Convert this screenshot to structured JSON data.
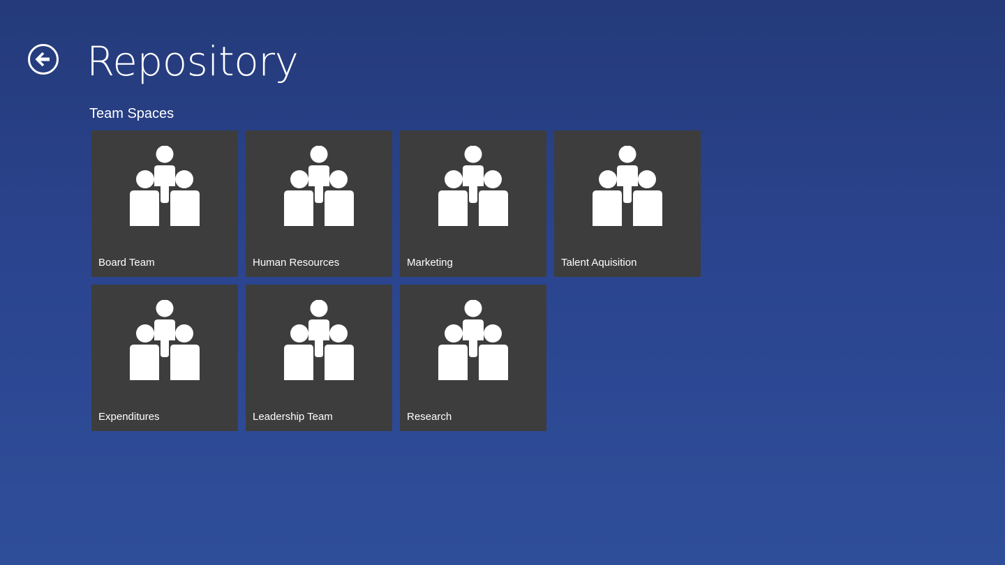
{
  "header": {
    "title": "Repository",
    "back_icon": "back-arrow-circle-icon"
  },
  "section": {
    "title": "Team Spaces"
  },
  "colors": {
    "background_top": "#243a7a",
    "background_bottom": "#2f4e9a",
    "tile_background": "#3d3d3d",
    "foreground": "#ffffff"
  },
  "tiles": [
    {
      "label": "Board Team",
      "icon": "team-icon"
    },
    {
      "label": "Human Resources",
      "icon": "team-icon"
    },
    {
      "label": "Marketing",
      "icon": "team-icon"
    },
    {
      "label": "Talent Aquisition",
      "icon": "team-icon"
    },
    {
      "label": "Expenditures",
      "icon": "team-icon"
    },
    {
      "label": "Leadership Team",
      "icon": "team-icon"
    },
    {
      "label": "Research",
      "icon": "team-icon"
    }
  ]
}
